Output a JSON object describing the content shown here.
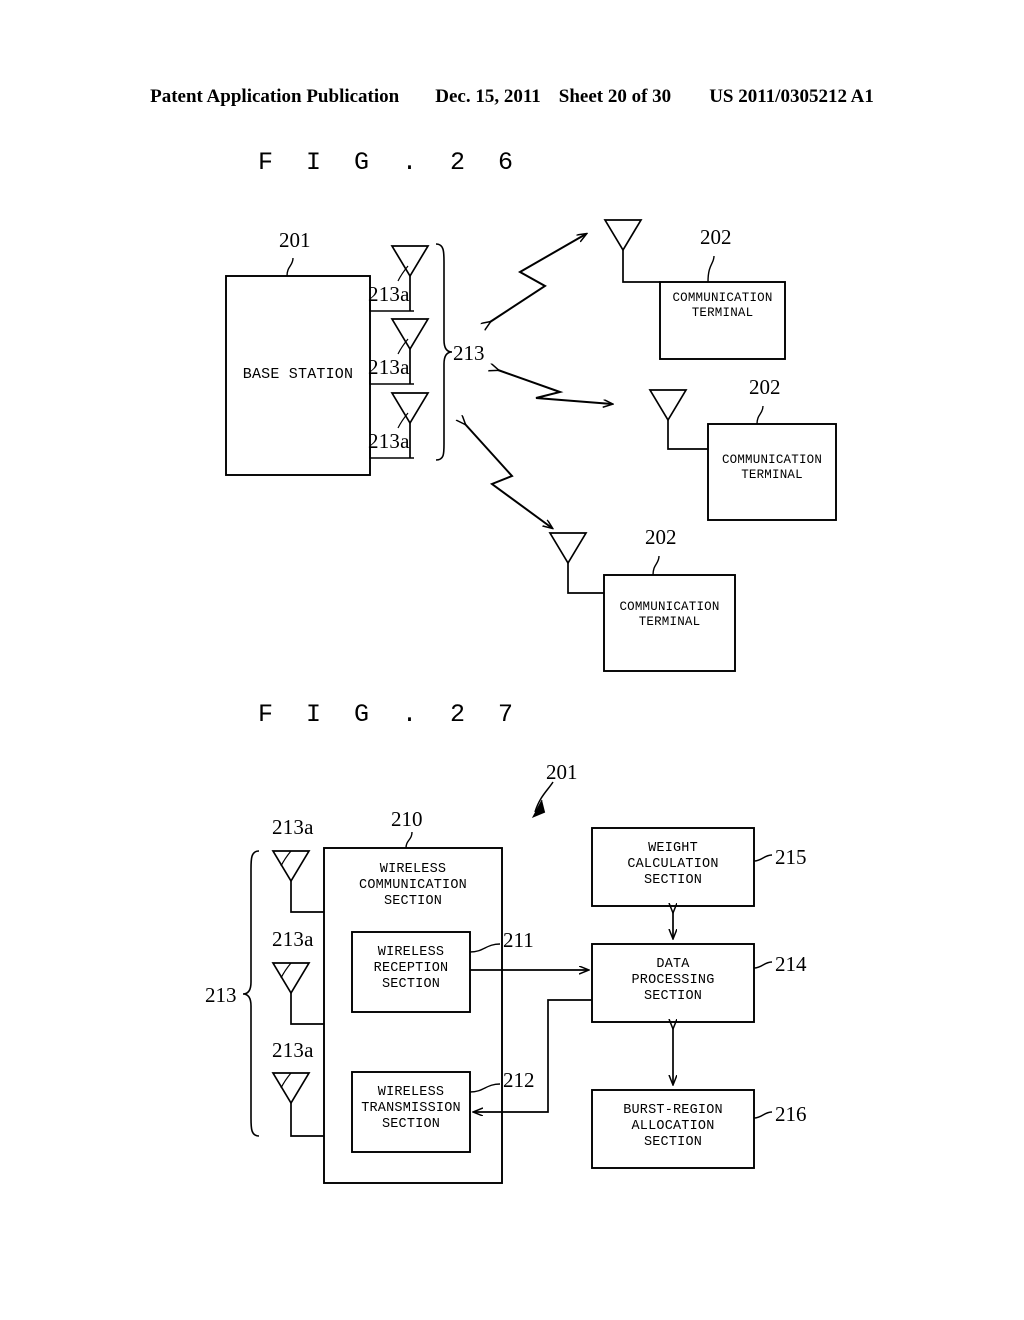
{
  "header": {
    "publication": "Patent Application Publication",
    "date": "Dec. 15, 2011",
    "sheet": "Sheet 20 of 30",
    "docnum": "US 2011/0305212 A1"
  },
  "figures": [
    {
      "id": "fig26",
      "title": "F I G .  2 6",
      "base_station": {
        "label": "BASE STATION",
        "ref": "201",
        "antenna_refs": [
          "213a",
          "213a",
          "213a"
        ],
        "antenna_group_ref": "213"
      },
      "terminals": [
        {
          "label": "COMMUNICATION\nTERMINAL",
          "ref": "202"
        },
        {
          "label": "COMMUNICATION\nTERMINAL",
          "ref": "202"
        },
        {
          "label": "COMMUNICATION\nTERMINAL",
          "ref": "202"
        }
      ],
      "links": [
        {
          "name": "radio-link-1"
        },
        {
          "name": "radio-link-2"
        },
        {
          "name": "radio-link-3"
        }
      ]
    },
    {
      "id": "fig27",
      "title": "F I G .  2 7",
      "device_ref": "201",
      "antenna_refs": [
        "213a",
        "213a",
        "213a"
      ],
      "antenna_group_ref": "213",
      "blocks": [
        {
          "key": "wireless_communication",
          "label": "WIRELESS\nCOMMUNICATION\nSECTION",
          "ref": "210"
        },
        {
          "key": "wireless_reception",
          "label": "WIRELESS\nRECEPTION\nSECTION",
          "ref": "211"
        },
        {
          "key": "wireless_transmission",
          "label": "WIRELESS\nTRANSMISSION\nSECTION",
          "ref": "212"
        },
        {
          "key": "weight_calculation",
          "label": "WEIGHT\nCALCULATION\nSECTION",
          "ref": "215"
        },
        {
          "key": "data_processing",
          "label": "DATA\nPROCESSING\nSECTION",
          "ref": "214"
        },
        {
          "key": "burst_region_allocation",
          "label": "BURST-REGION\nALLOCATION\nSECTION",
          "ref": "216"
        }
      ]
    }
  ],
  "colors": {
    "ink": "#000000",
    "paper": "#ffffff"
  }
}
